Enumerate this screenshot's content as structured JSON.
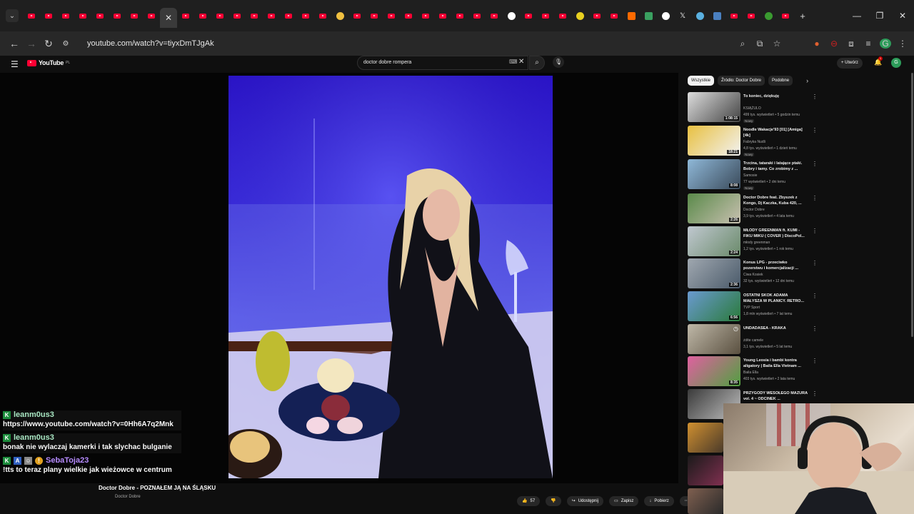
{
  "browser": {
    "url": "youtube.com/watch?v=tiyxDmTJgAk"
  },
  "youtube": {
    "logo_text": "YouTube",
    "logo_suffix": "PL",
    "search_value": "doctor dobre rompera",
    "create_label": "Utwórz",
    "notification_count": "1",
    "avatar_letter": "G"
  },
  "video": {
    "title": "Doctor Dobre - POZNAŁEM JĄ NA ŚLĄSKU",
    "channel": "Doctor Dobre",
    "likes": "57",
    "share_label": "Udostępnij",
    "save_label": "Zapisz",
    "download_label": "Pobierz"
  },
  "chips": [
    "Wszystkie",
    "Źródło: Doctor Dobre",
    "Podobne"
  ],
  "recommendations": [
    {
      "title": "To koniec, dziękuję",
      "channel": "KSIĄŻULO",
      "meta": "499 tys. wyświetleń • 5 godzin temu",
      "badge": "Nowy",
      "duration": "1:08:15"
    },
    {
      "title": "Noodle Wakacje'93 [01] [Amiga] [4k]",
      "channel": "Fabryka Nudli",
      "meta": "4,8 tys. wyświetleń • 1 dzień temu",
      "badge": "Nowy",
      "duration": "18:21"
    },
    {
      "title": "Trzcina, tataraki i latające ptaki. Bobry i tamy. Co zrobimy z ...",
      "channel": "Samosie",
      "meta": "77 wyświetleń • 2 dni temu",
      "badge": "Nowy",
      "duration": "8:08"
    },
    {
      "title": "Doctor Dobre feat. Zbyszek z Kongo, Dj Kaczka, Kuba 420, ...",
      "channel": "Doctor Dobre",
      "meta": "3,9 tys. wyświetleń • 4 lata temu",
      "badge": "",
      "duration": "2:26"
    },
    {
      "title": "MŁODY GREENMAN ft. KUMI - FIKU MIKU ( COVER ) DiscoPol...",
      "channel": "młody greenman",
      "meta": "1,2 tys. wyświetleń • 1 rok temu",
      "badge": "",
      "duration": "2:24"
    },
    {
      "title": "Konus LPG - przeciwko pozerstwu i komercjalizacji ...",
      "channel": "Ciwa Kosiek",
      "meta": "32 tys. wyświetleń • 12 dni temu",
      "badge": "",
      "duration": "2:36"
    },
    {
      "title": "OSTATNI SKOK ADAMA MAŁYSZA W PLANICY. RETRO...",
      "channel": "TVP Sport",
      "meta": "1,8 mln wyświetleń • 7 lat temu",
      "badge": "",
      "duration": "6:56"
    },
    {
      "title": "UNDADASEA - KRAKA",
      "channel": "żółte camele",
      "meta": "3,1 tys. wyświetleń • 5 lat temu",
      "badge": "",
      "duration": ""
    },
    {
      "title": "Young Leosia i bambi kontra aligatory | Baila Ella Vietnam ...",
      "channel": "Baila Ella",
      "meta": "403 tys. wyświetleń • 2 lata temu",
      "badge": "",
      "duration": "8:35"
    },
    {
      "title": "PRZYGODY WESOŁEGO MAZURA vol. 4 ~ ODCINEK ...",
      "channel": "",
      "meta": "",
      "badge": "",
      "duration": ""
    }
  ],
  "chat": [
    {
      "user": "leanm0us3",
      "message": "https://www.youtube.com/watch?v=0Hh6A7q2Mnk"
    },
    {
      "user": "leanm0us3",
      "message": "bonak nie wylaczaj kamerki i tak slychac bulganie"
    },
    {
      "user": "SebaToja23",
      "message": "!tts to teraz plany wielkie jak wieżowce w centrum"
    }
  ],
  "colors": {
    "youtube_red": "#ff0033",
    "background": "#0f0f0f",
    "video_blue": "#3b2de0"
  }
}
